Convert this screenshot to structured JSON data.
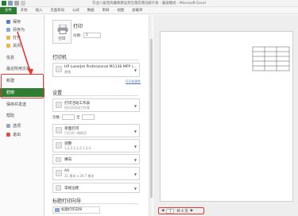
{
  "window": {
    "title": "毕业八届党风廉政建设责任落实情况统计表 - 兼容模式 - Microsoft Excel"
  },
  "ribbon": {
    "tabs": [
      "文件",
      "开始",
      "插入",
      "页面布局",
      "公式",
      "数据",
      "审阅",
      "视图",
      "加载项"
    ]
  },
  "menu": {
    "items": [
      "保存",
      "另存为",
      "打开",
      "关闭",
      "信息",
      "最近所用文件",
      "新建",
      "打印",
      "保存并发送",
      "帮助",
      "选项",
      "退出"
    ]
  },
  "print": {
    "header": "打印",
    "button_label": "打印",
    "copies_label": "份数:",
    "copies_value": "1",
    "printer_section": "打印机",
    "printer_name": "HP LaserJet Professional M1136 MFP (...",
    "printer_status": "就绪",
    "printer_props": "打印机属性",
    "settings_section": "设置",
    "scope_title": "打印活动工作表",
    "scope_desc": "仅打印活动工作表",
    "pages_label": "页数:",
    "pages_to": "至",
    "sides_title": "单面打印",
    "sides_desc": "只打印一侧的页",
    "collate_title": "调整",
    "collate_desc": "1,2,3    1,2,3    1,2,3",
    "orientation": "横向",
    "paper_title": "A4",
    "paper_desc": "21 厘米 x 29.7 厘米",
    "margins": "常规边距",
    "guide_section": "标题打印向导",
    "guide_link": "标题打印向导"
  },
  "preview": {
    "page_current": "1",
    "page_total": "共 4 页"
  },
  "colors": {
    "accent": "#2e7d32",
    "annotation": "#e53935"
  }
}
